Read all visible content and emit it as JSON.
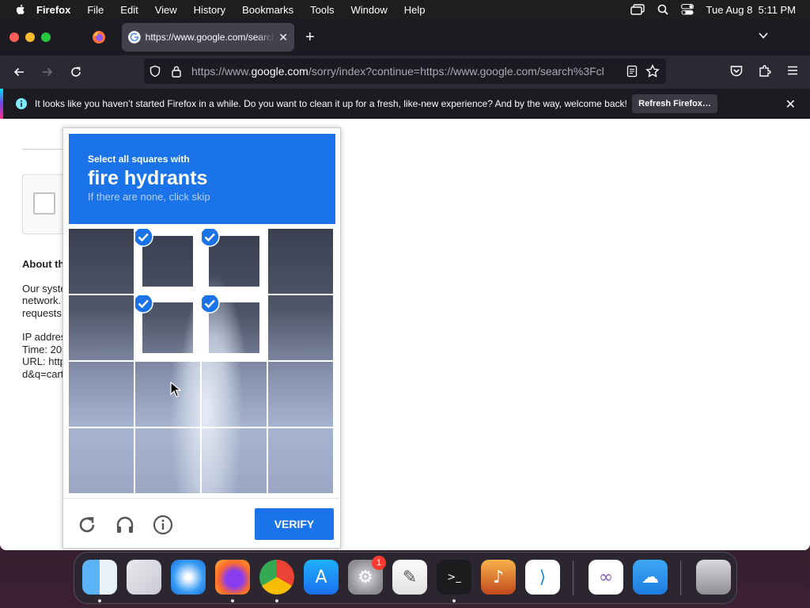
{
  "menubar": {
    "app": "Firefox",
    "items": [
      "File",
      "Edit",
      "View",
      "History",
      "Bookmarks",
      "Tools",
      "Window",
      "Help"
    ],
    "clock": "Tue Aug 8  5:11 PM"
  },
  "tab": {
    "title": "https://www.google.com/search?q"
  },
  "urlbar": {
    "scheme": "https://www.",
    "host": "google.com",
    "path": "/sorry/index?continue=https://www.google.com/search%3Fcl"
  },
  "notification": {
    "message": "It looks like you haven’t started Firefox in a while. Do you want to clean it up for a fresh, like-new experience? And by the way, welcome back!",
    "button": "Refresh Firefox…"
  },
  "page_background": {
    "about_heading": "About th",
    "para_lines": [
      "Our syste",
      "network.",
      "requests"
    ],
    "ip_line": "IP addres",
    "time_line": "Time: 20",
    "url_line": "URL: http",
    "q_line": "d&q=cart"
  },
  "captcha": {
    "instruction_small": "Select all squares with",
    "target": "fire hydrants",
    "hint": "If there are none, click skip",
    "verify": "VERIFY",
    "selected_tiles": [
      1,
      2,
      5,
      6
    ],
    "accent": "#1a73e8"
  },
  "dock": {
    "apps": [
      "Finder",
      "Launchpad",
      "Safari",
      "Firefox",
      "Google Chrome",
      "App Store",
      "System Settings",
      "TextEdit",
      "Terminal",
      "GarageBand",
      "Visual Studio Code",
      "Visual Studio",
      "Weather",
      "Trash"
    ],
    "settings_badge": "1"
  }
}
